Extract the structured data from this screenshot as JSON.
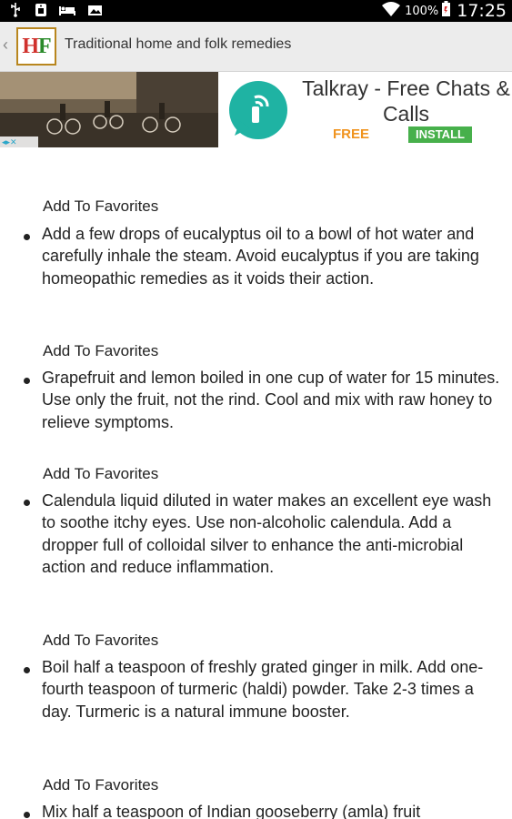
{
  "status_bar": {
    "battery_percent": "100%",
    "time": "17:25",
    "icons": [
      "usb-icon",
      "sim-icon",
      "sleep-icon",
      "photo-icon",
      "wifi-icon",
      "battery-icon"
    ]
  },
  "app_bar": {
    "back_icon": "chevron-left-icon",
    "logo_text_left": "H",
    "logo_text_right": "F",
    "title": "Traditional home and folk remedies"
  },
  "ad": {
    "title": "Talkray - Free Chats & Calls",
    "free_label": "FREE",
    "install_label": "INSTALL",
    "info_icon": "adchoices-icon",
    "app_icon": "talkray-icon",
    "colors": {
      "free": "#f0931e",
      "install": "#47b04b",
      "icon": "#1fb3a3"
    }
  },
  "entries": [
    {
      "fav_label": "Add To Favorites",
      "text": " Add a few drops of eucalyptus oil to a bowl of hot water and carefully inhale the steam. Avoid eucalyptus if you are taking homeopathic remedies as it voids their action."
    },
    {
      "fav_label": "Add To Favorites",
      "text": "Grapefruit and lemon boiled in one cup of water for 15 minutes. Use only the fruit, not the rind. Cool and mix with raw honey to relieve symptoms."
    },
    {
      "fav_label": "Add To Favorites",
      "text": "Calendula liquid diluted in water makes an excellent eye wash to soothe itchy eyes. Use non-alcoholic calendula. Add a dropper full of colloidal silver to enhance the anti-microbial action and reduce inflammation."
    },
    {
      "fav_label": "Add To Favorites",
      "text": "Boil half a teaspoon of freshly grated ginger in milk. Add one-fourth teaspoon of turmeric (haldi) powder. Take 2-3 times a day. Turmeric is a natural immune booster."
    },
    {
      "fav_label": "Add To Favorites",
      "text": "Mix half a teaspoon of Indian gooseberry (amla) fruit"
    }
  ]
}
